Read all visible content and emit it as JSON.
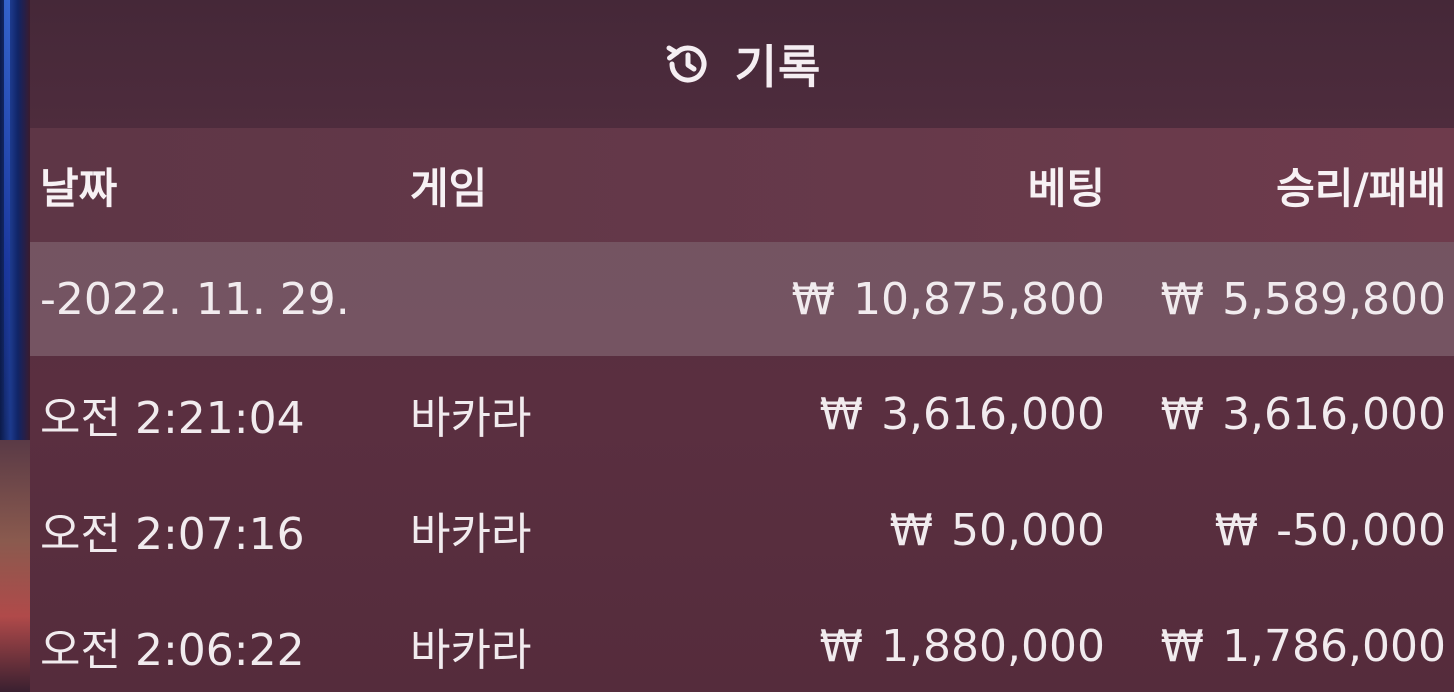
{
  "header": {
    "title": "기록",
    "icon": "history-icon"
  },
  "columns": {
    "date": "날짜",
    "game": "게임",
    "bet": "베팅",
    "result": "승리/패배"
  },
  "currency_symbol": "₩",
  "summary": {
    "date": "-2022. 11. 29.",
    "bet": "10,875,800",
    "result": "5,589,800"
  },
  "rows": [
    {
      "time": "오전 2:21:04",
      "game": "바카라",
      "bet": "3,616,000",
      "result": "3,616,000"
    },
    {
      "time": "오전 2:07:16",
      "game": "바카라",
      "bet": "50,000",
      "result": "-50,000"
    },
    {
      "time": "오전 2:06:22",
      "game": "바카라",
      "bet": "1,880,000",
      "result": "1,786,000"
    }
  ],
  "colors": {
    "panel": "#57303f",
    "summary_row": "#8c737d",
    "text": "#f1ebee"
  }
}
